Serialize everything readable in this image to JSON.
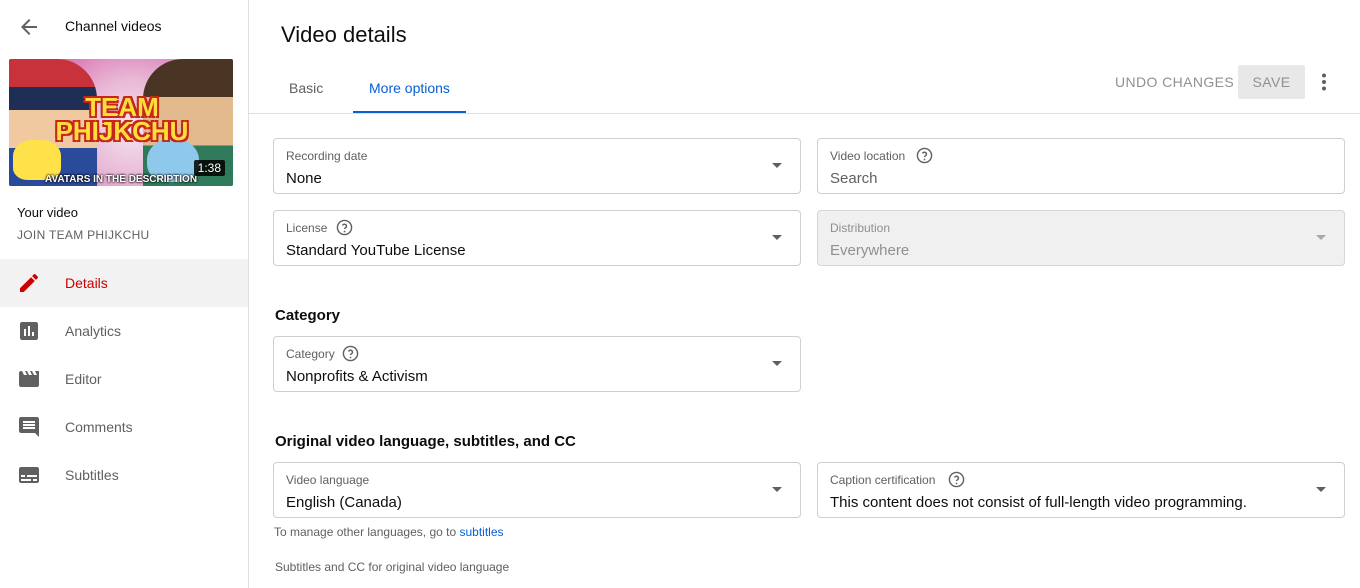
{
  "sidebar": {
    "back_title": "Channel videos",
    "thumbnail": {
      "title_line1": "TEAM",
      "title_line2": "PHIJKCHU",
      "caption": "AVATARS IN THE DESCRIPTION",
      "duration": "1:38"
    },
    "your_video_label": "Your video",
    "channel_name": "JOIN TEAM PHIJKCHU",
    "nav": [
      {
        "label": "Details",
        "icon": "pencil-icon",
        "active": true
      },
      {
        "label": "Analytics",
        "icon": "analytics-icon",
        "active": false
      },
      {
        "label": "Editor",
        "icon": "clapperboard-icon",
        "active": false
      },
      {
        "label": "Comments",
        "icon": "comment-icon",
        "active": false
      },
      {
        "label": "Subtitles",
        "icon": "subtitles-icon",
        "active": false
      }
    ]
  },
  "main": {
    "title": "Video details",
    "tabs": [
      {
        "label": "Basic",
        "active": false
      },
      {
        "label": "More options",
        "active": true
      }
    ],
    "undo_label": "UNDO CHANGES",
    "save_label": "SAVE",
    "fields": {
      "recording_date": {
        "label": "Recording date",
        "value": "None"
      },
      "video_location": {
        "label": "Video location",
        "placeholder": "Search"
      },
      "license": {
        "label": "License",
        "value": "Standard YouTube License"
      },
      "distribution": {
        "label": "Distribution",
        "value": "Everywhere"
      },
      "category": {
        "label": "Category",
        "value": "Nonprofits & Activism"
      },
      "video_language": {
        "label": "Video language",
        "value": "English (Canada)"
      },
      "caption_certification": {
        "label": "Caption certification",
        "value": "This content does not consist of full-length video programming."
      }
    },
    "category_section_title": "Category",
    "language_section_title": "Original video language, subtitles, and CC",
    "helper_text": "To manage other languages, go to ",
    "helper_link": "subtitles",
    "subtitles_label": "Subtitles and CC for original video language"
  },
  "colors": {
    "accent_blue": "#065fd4",
    "active_red": "#cc0000",
    "border": "#cfcfcf"
  }
}
